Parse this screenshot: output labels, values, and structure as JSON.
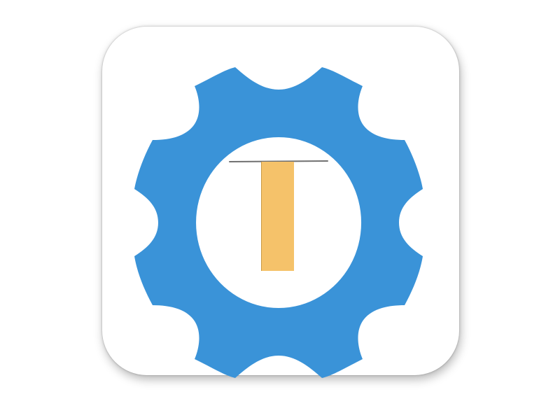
{
  "app_icon": {
    "name": "settings-gear-app-icon",
    "glyph": "gear-with-letter-t",
    "colors": {
      "background": "#ffffff",
      "tile": "#ffffff",
      "gear": "#3a93d8",
      "gear_hole": "#ffffff",
      "letter_stem": "#f5c26a",
      "letter_bar": "#707070"
    }
  }
}
